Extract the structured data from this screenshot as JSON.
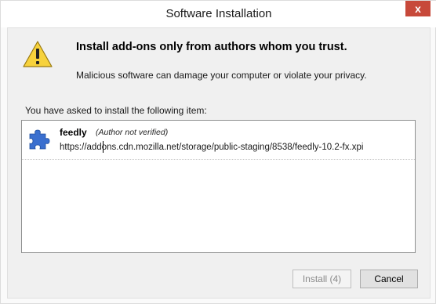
{
  "window": {
    "title": "Software Installation",
    "close_label": "x"
  },
  "warning": {
    "icon": "warning-icon",
    "headline": "Install add-ons only from authors whom you trust.",
    "subtext": "Malicious software can damage your computer or violate your privacy."
  },
  "list": {
    "label": "You have asked to install the following item:",
    "items": [
      {
        "icon": "puzzle-piece-icon",
        "name": "feedly",
        "author": "(Author not verified)",
        "url": "https://addons.cdn.mozilla.net/storage/public-staging/8538/feedly-10.2-fx.xpi"
      }
    ]
  },
  "buttons": {
    "install_label": "Install (4)",
    "cancel_label": "Cancel"
  },
  "colors": {
    "close_button": "#c7493a",
    "warning_fill": "#f7d23c",
    "puzzle_fill": "#3a6fcf"
  }
}
